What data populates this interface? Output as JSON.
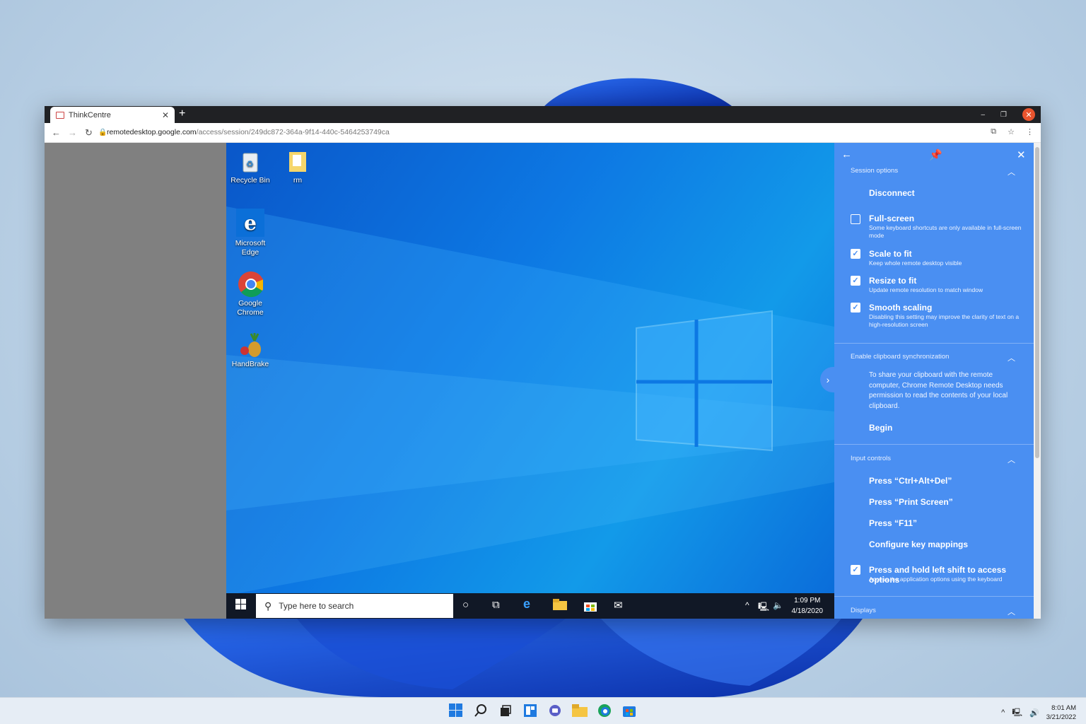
{
  "browser": {
    "tab_title": "ThinkCentre",
    "new_tab": "+",
    "url_host": "remotedesktop.google.com",
    "url_path": "/access/session/249dc872-364a-9f14-440c-5464253749ca"
  },
  "remote_desktop": {
    "icons": [
      {
        "label": "Recycle Bin"
      },
      {
        "label": "rm"
      },
      {
        "label": "Microsoft Edge"
      },
      {
        "label": "Google Chrome"
      },
      {
        "label": "HandBrake"
      }
    ],
    "search_placeholder": "Type here to search",
    "time": "1:09 PM",
    "date": "4/18/2020"
  },
  "panel": {
    "session_options": "Session options",
    "disconnect": "Disconnect",
    "full_screen": {
      "label": "Full-screen",
      "desc": "Some keyboard shortcuts are only available in full-screen mode",
      "checked": false
    },
    "scale_to_fit": {
      "label": "Scale to fit",
      "desc": "Keep whole remote desktop visible",
      "checked": true
    },
    "resize_to_fit": {
      "label": "Resize to fit",
      "desc": "Update remote resolution to match window",
      "checked": true
    },
    "smooth_scaling": {
      "label": "Smooth scaling",
      "desc": "Disabling this setting may improve the clarity of text on a high-resolution screen",
      "checked": true
    },
    "clipboard_header": "Enable clipboard synchronization",
    "clipboard_text": "To share your clipboard with the remote computer, Chrome Remote Desktop needs permission to read the contents of your local clipboard.",
    "begin": "Begin",
    "input_controls": "Input controls",
    "ctrl_alt_del": "Press “Ctrl+Alt+Del”",
    "print_screen": "Press “Print Screen”",
    "f11": "Press “F11”",
    "key_mappings": "Configure key mappings",
    "left_shift": {
      "label": "Press and hold left shift to access options",
      "desc": "Access the application options using the keyboard",
      "checked": true
    },
    "displays": "Displays"
  },
  "host_taskbar": {
    "time": "8:01 AM",
    "date": "3/21/2022"
  },
  "colors": {
    "panel": "#4a8ff2",
    "remote_taskbar": "#111826",
    "accent": "#0d78e3"
  }
}
